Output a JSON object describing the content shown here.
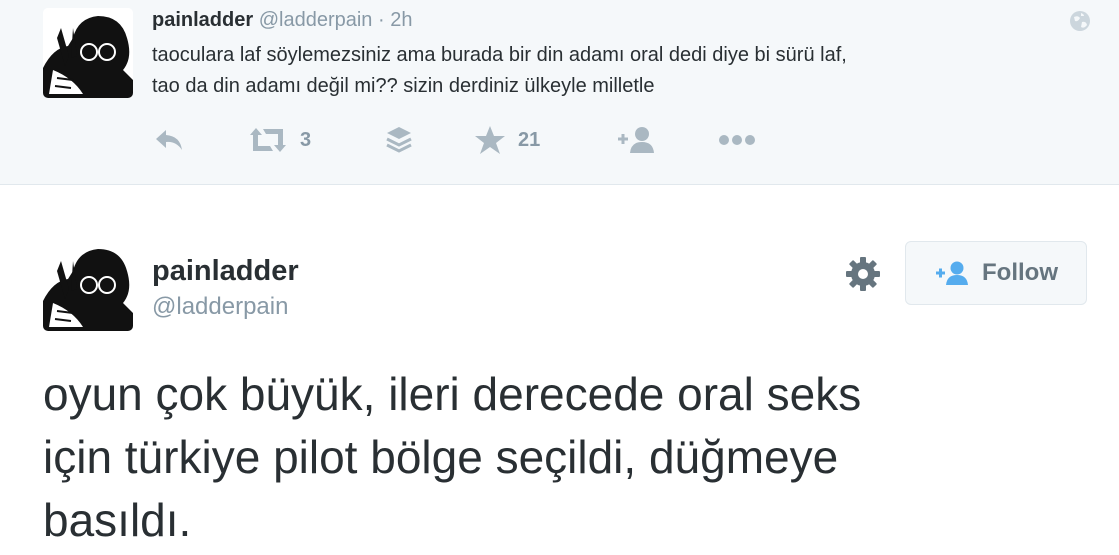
{
  "top_tweet": {
    "name": "painladder",
    "handle": "@ladderpain",
    "separator": "·",
    "time": "2h",
    "text_lines": [
      "taoculara laf söylemezsiniz ama burada bir din adamı oral dedi diye bi sürü laf,",
      "tao da din adamı değil mi?? sizin derdiniz ülkeyle milletle"
    ],
    "actions": {
      "reply_icon": "reply-icon",
      "retweet_icon": "retweet-icon",
      "retweet_count": "3",
      "buffer_icon": "layers-icon",
      "favorite_icon": "star-icon",
      "favorite_count": "21",
      "follow_icon": "add-user-icon",
      "more_icon": "more-dots-icon"
    },
    "globe_icon": "globe-icon"
  },
  "main_tweet": {
    "name": "painladder",
    "handle": "@ladderpain",
    "gear_icon": "gear-icon",
    "follow_label": "Follow",
    "follow_icon": "add-user-icon",
    "text_lines": [
      "oyun çok büyük, ileri derecede oral seks",
      "için türkiye pilot bölge seçildi, düğmeye",
      "basıldı."
    ]
  },
  "colors": {
    "top_background": "#f5f8fa",
    "text": "#292f33",
    "muted": "#8899a6",
    "icon": "#aab8c2",
    "follow_icon": "#55acee"
  }
}
